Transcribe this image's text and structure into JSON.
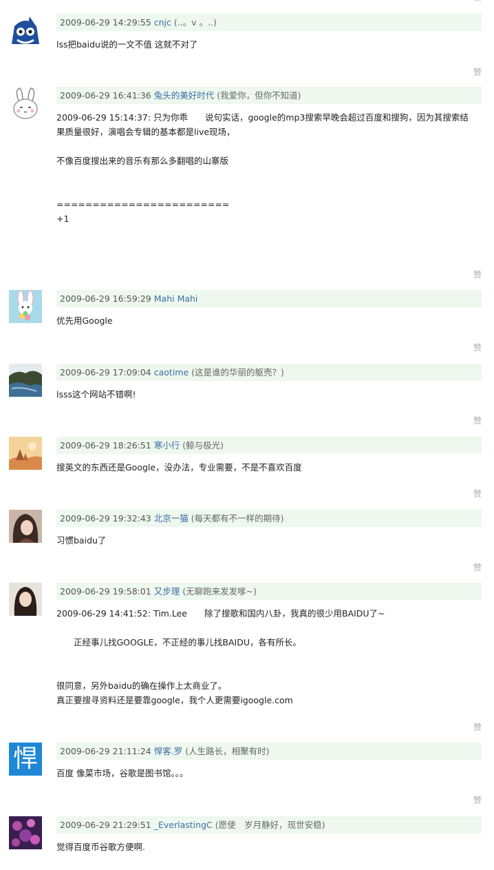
{
  "like_label": "赞",
  "comments": [
    {
      "time": "2009-06-29 14:29:55",
      "user": "cnjc",
      "sig": "(..。v 。..)",
      "avatar": "cartoon-avatar",
      "lines": [
        "lss把baidu说的一文不值 这就不对了"
      ]
    },
    {
      "time": "2009-06-29 16:41:36",
      "user": "兔头的美好时代",
      "sig": "(我爱你，但你不知道)",
      "avatar": "bunny-avatar",
      "lines": [
        "2009-06-29 15:14:37: 只为你乖　　说句实话，google的mp3搜索早晚会超过百度和搜狗，因为其搜索结",
        "果质量很好，演唱会专辑的基本都是live现场，",
        "",
        "不像百度搜出来的音乐有那么多翻唱的山寨版",
        "",
        "",
        "========================",
        "+1"
      ]
    },
    {
      "time": "2009-06-29 16:59:29",
      "user": "Mahi Mahi",
      "sig": "",
      "avatar": "rabbit-doll-avatar",
      "lines": [
        "优先用Google"
      ]
    },
    {
      "time": "2009-06-29 17:09:04",
      "user": "caotime",
      "sig": "(这是谁的华丽的躯壳？)",
      "avatar": "landscape-avatar",
      "lines": [
        "lsss这个网站不错啊!"
      ]
    },
    {
      "time": "2009-06-29 18:26:51",
      "user": "寒小行",
      "sig": "(鲸与极光)",
      "avatar": "desert-avatar",
      "lines": [
        "搜英文的东西还是Google，没办法，专业需要，不是不喜欢百度"
      ]
    },
    {
      "time": "2009-06-29 19:32:43",
      "user": "北京一猫",
      "sig": "(每天都有不一样的期待)",
      "avatar": "girl-avatar",
      "lines": [
        "习惯baidu了"
      ]
    },
    {
      "time": "2009-06-29 19:58:01",
      "user": "又步理",
      "sig": "(无聊跑来发发嗲~)",
      "avatar": "woman-avatar",
      "lines": [
        "2009-06-29 14:41:52: Tim.Lee　　除了搜歌和国内八卦，我真的很少用BAIDU了~",
        "",
        "　　正经事儿找GOOGLE，不正经的事儿找BAIDU，各有所长。",
        "",
        "",
        "很同意，另外baidu的确在操作上太商业了。",
        "真正要搜寻资料还是要靠google，我个人更需要igoogle.com"
      ]
    },
    {
      "time": "2009-06-29 21:11:24",
      "user": "悍客.罗",
      "sig": "(人生路长，相聚有时)",
      "avatar": "han-char-avatar",
      "avatar_text": "悍",
      "lines": [
        "百度 像菜市场，谷歌是图书馆。。。"
      ]
    },
    {
      "time": "2009-06-29 21:29:51",
      "user": "_EverlastingC",
      "sig": "(愿使　岁月静好，现世安稳)",
      "avatar": "purple-avatar",
      "lines": [
        "觉得百度币谷歌方便啊."
      ]
    }
  ]
}
